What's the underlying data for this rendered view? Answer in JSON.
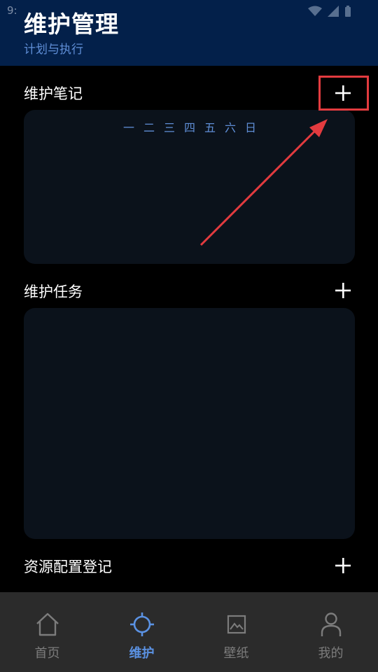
{
  "status_bar": {
    "time": "9:"
  },
  "header": {
    "title": "维护管理",
    "subtitle": "计划与执行"
  },
  "sections": [
    {
      "title": "维护笔记",
      "add_label": "+"
    },
    {
      "title": "维护任务",
      "add_label": "+"
    },
    {
      "title": "资源配置登记",
      "add_label": "+"
    }
  ],
  "calendar": {
    "weekdays": [
      "一",
      "二",
      "三",
      "四",
      "五",
      "六",
      "日"
    ]
  },
  "nav": [
    {
      "label": "首页",
      "icon": "home-icon",
      "active": false
    },
    {
      "label": "维护",
      "icon": "crosshair-icon",
      "active": true
    },
    {
      "label": "壁纸",
      "icon": "picture-icon",
      "active": false
    },
    {
      "label": "我的",
      "icon": "person-icon",
      "active": false
    }
  ],
  "colors": {
    "header_bg": "#03204a",
    "accent": "#5b92e3",
    "card_bg": "#0b121b",
    "nav_bg": "#2b2b2b",
    "annotation_red": "#e33b3f"
  }
}
